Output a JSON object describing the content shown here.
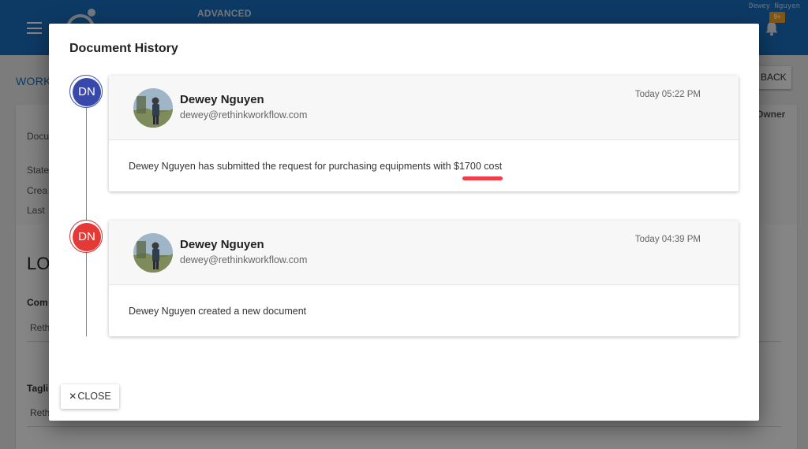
{
  "header": {
    "edition_label": "ADVANCED",
    "user_name": "Dewey Nguyen",
    "notification_count": "9+"
  },
  "background": {
    "breadcrumb": "WORK",
    "back_label": "BACK",
    "owner_column": "Owner",
    "field_labels": [
      "Docu",
      "State",
      "Crea",
      "Last"
    ],
    "section_heading": "LO",
    "com_label": "Com",
    "rethink_1": "Reth",
    "tag_label": "Tagli",
    "rethink_2": "Reth"
  },
  "dialog": {
    "title": "Document History",
    "close_label": "CLOSE",
    "entries": [
      {
        "initials": "DN",
        "author": "Dewey Nguyen",
        "email": "dewey@rethinkworkflow.com",
        "time": "Today 05:22 PM",
        "message": "Dewey Nguyen has submitted the request for purchasing equipments with $1700 cost",
        "dot_color": "#3949ab"
      },
      {
        "initials": "DN",
        "author": "Dewey Nguyen",
        "email": "dewey@rethinkworkflow.com",
        "time": "Today 04:39 PM",
        "message": "Dewey Nguyen created a new document",
        "dot_color": "#e53935"
      }
    ]
  },
  "colors": {
    "topbar": "#1a6fc1",
    "highlight": "#ef3e4a",
    "timeline": "#c0392b"
  },
  "icons": {
    "menu": "hamburger-icon",
    "notifications": "bell-icon",
    "close": "close-icon"
  }
}
